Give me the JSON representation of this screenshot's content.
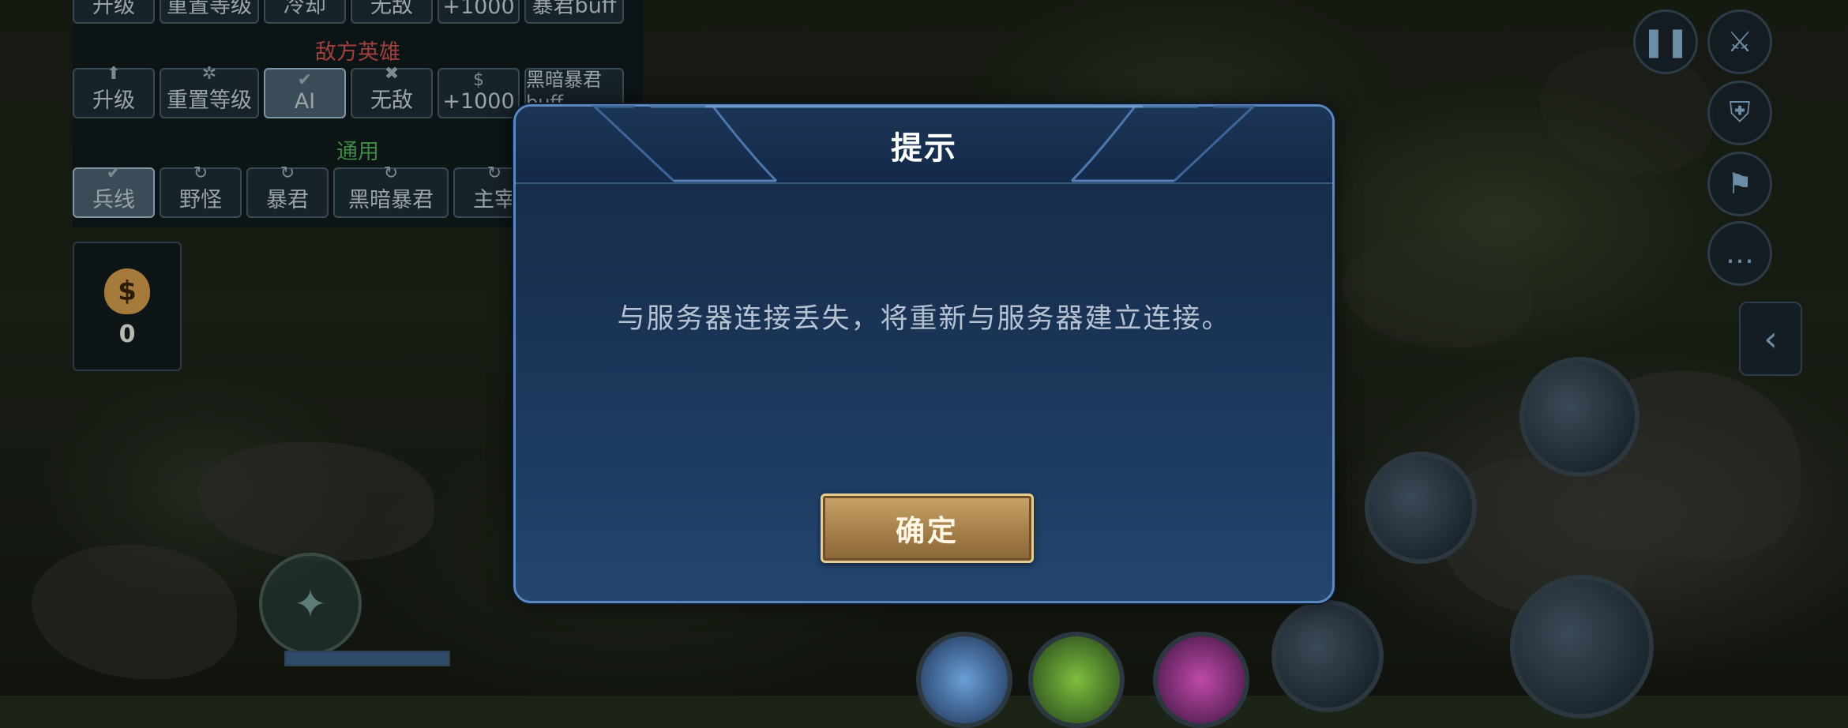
{
  "debug_panel": {
    "row1": [
      "升级",
      "重置等级",
      "冷却",
      "无敌",
      "+1000",
      "暴君buff"
    ],
    "enemy_section_title": "敌方英雄",
    "row2": [
      "升级",
      "重置等级",
      "AI",
      "无敌",
      "+1000",
      "黑暗暴君buff"
    ],
    "general_section_title": "通用",
    "row3": [
      "兵线",
      "野怪",
      "暴君",
      "黑暗暴君",
      "主宰"
    ]
  },
  "gold": {
    "count": "0"
  },
  "dialog": {
    "title": "提示",
    "message": "与服务器连接丢失，将重新与服务器建立连接。",
    "confirm_label": "确定"
  },
  "colors": {
    "dialog_border": "#5c88c2",
    "dialog_bg_top": "#152a46",
    "confirm_gold": "#c9a56a",
    "enemy_title": "#a0413e",
    "general_title": "#3f8a43"
  },
  "right_controls": [
    "pause-icon",
    "sword-icon",
    "shield-icon",
    "flag-icon",
    "chat-icon",
    "chevron-left-icon"
  ]
}
